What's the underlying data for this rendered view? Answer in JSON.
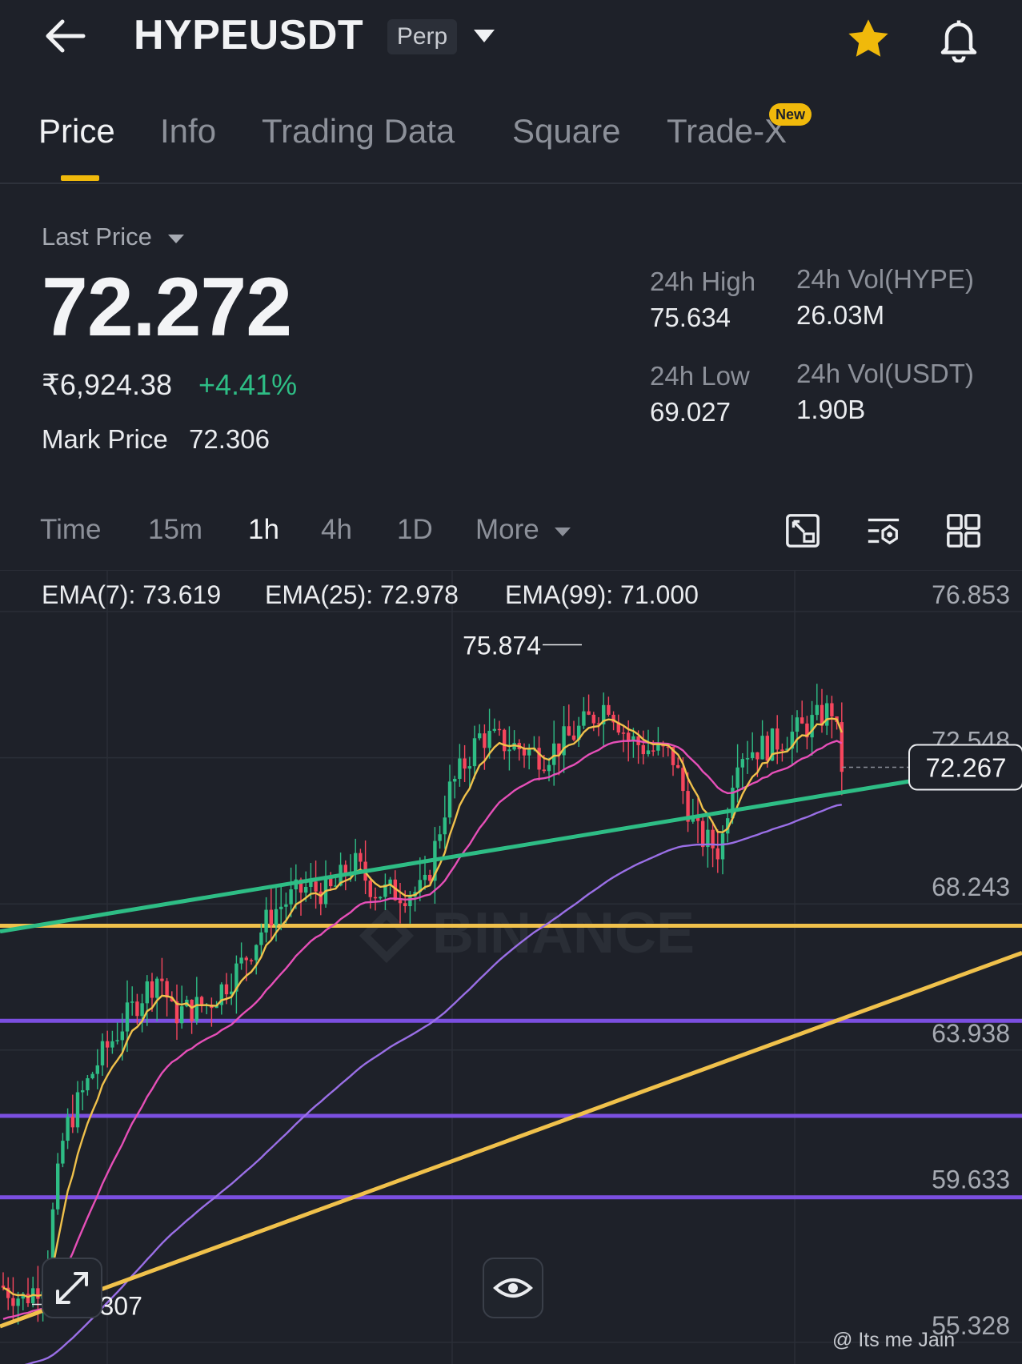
{
  "header": {
    "symbol": "HYPEUSDT",
    "contract_badge": "Perp",
    "back_icon": "arrow-left-icon",
    "favorite_icon": "star-icon",
    "alert_icon": "bell-icon",
    "favorite_color": "#f0b90b"
  },
  "tabs": [
    {
      "label": "Price",
      "active": true
    },
    {
      "label": "Info"
    },
    {
      "label": "Trading Data"
    },
    {
      "label": "Square"
    },
    {
      "label": "Trade-X",
      "badge": "New"
    }
  ],
  "ticker": {
    "price_type_label": "Last Price",
    "last_price": "72.272",
    "fiat_price": "₹6,924.38",
    "change_percent": "+4.41%",
    "mark_price_label": "Mark Price",
    "mark_price": "72.306",
    "stats": {
      "high_label": "24h High",
      "high": "75.634",
      "low_label": "24h Low",
      "low": "69.027",
      "vol_base_label": "24h Vol(HYPE)",
      "vol_base": "26.03M",
      "vol_quote_label": "24h Vol(USDT)",
      "vol_quote": "1.90B"
    },
    "up_color": "#2ebd85",
    "down_color": "#f6465d"
  },
  "intervals": {
    "items": [
      "Time",
      "15m",
      "1h",
      "4h",
      "1D"
    ],
    "more_label": "More",
    "selected": "1h",
    "tool_icons": [
      "chart-screenshot-icon",
      "indicator-settings-icon",
      "layout-grid-icon"
    ]
  },
  "indicators": {
    "ema7": "EMA(7): 73.619",
    "ema25": "EMA(25): 72.978",
    "ema99": "EMA(99): 71.000",
    "ema7_color": "#f0c14b",
    "ema25_color": "#e64fb8",
    "ema99_color": "#9a6fe6"
  },
  "chart": {
    "watermark": "BINANCE",
    "price_tag": "72.267",
    "max_label": "75.874",
    "min_label": "56.307",
    "y_ticks": [
      "76.853",
      "72.548",
      "68.243",
      "63.938",
      "59.633",
      "55.328"
    ],
    "expand_icon": "expand-arrows-icon",
    "visibility_icon": "eye-icon",
    "credit": "@ Its me Jain"
  },
  "chart_data": {
    "type": "candlestick",
    "title": "",
    "xlabel": "",
    "ylabel": "",
    "ylim": [
      55.328,
      76.853
    ],
    "y_ticks": [
      76.853,
      72.548,
      68.243,
      63.938,
      59.633,
      55.328
    ],
    "last_price": 72.267,
    "high_marker": 75.874,
    "low_marker": 56.307,
    "trendlines": [
      {
        "color": "#2ebd85",
        "from": [
          0,
          67.43
        ],
        "to": [
          1,
          72.4
        ]
      },
      {
        "color": "#f0c14b",
        "from": [
          0,
          55.8
        ],
        "to": [
          1,
          66.8
        ]
      }
    ],
    "horizontal_levels": [
      {
        "color": "#f0c14b",
        "price": 67.6
      },
      {
        "color": "#7b4fe0",
        "price": 64.8
      },
      {
        "color": "#7b4fe0",
        "price": 62.0
      },
      {
        "color": "#7b4fe0",
        "price": 59.6
      }
    ]
  }
}
